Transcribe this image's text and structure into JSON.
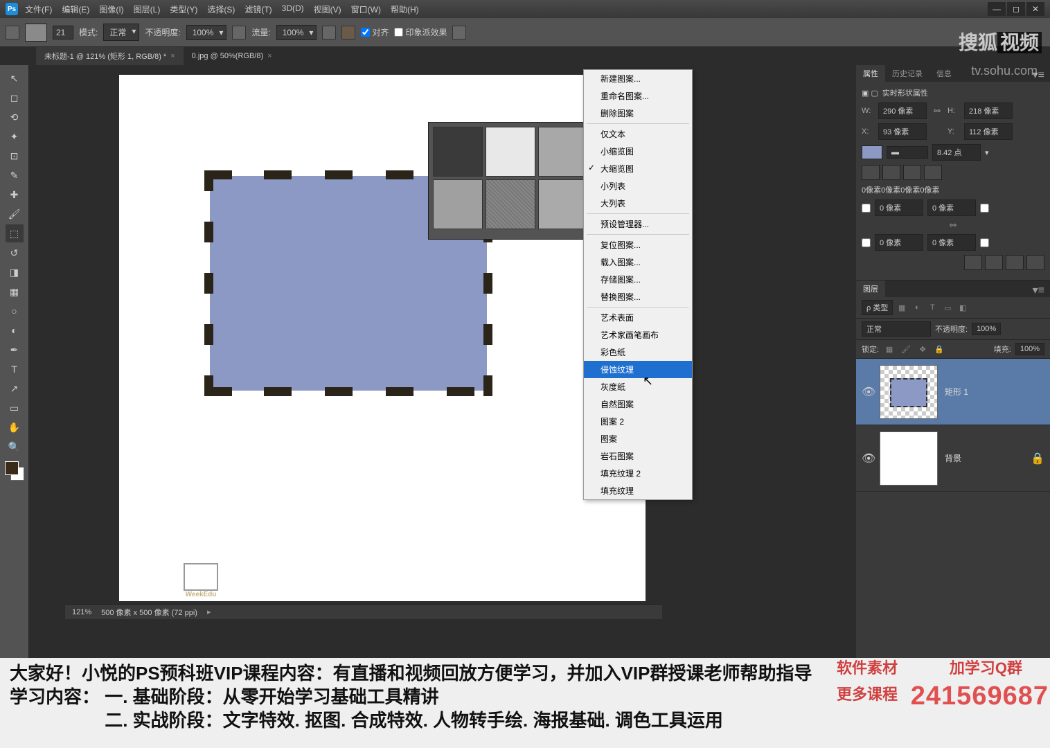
{
  "menu": [
    "文件(F)",
    "编辑(E)",
    "图像(I)",
    "图层(L)",
    "类型(Y)",
    "选择(S)",
    "滤镜(T)",
    "3D(D)",
    "视图(V)",
    "窗口(W)",
    "帮助(H)"
  ],
  "options": {
    "size": "21",
    "mode_label": "模式:",
    "mode_value": "正常",
    "opacity_label": "不透明度:",
    "opacity_value": "100%",
    "flow_label": "流量:",
    "flow_value": "100%",
    "align": "对齐",
    "impress": "印象派效果"
  },
  "tabs": [
    {
      "label": "未标题-1 @ 121% (矩形 1, RGB/8) *",
      "active": true
    },
    {
      "label": "0.jpg @ 50%(RGB/8)",
      "active": false
    }
  ],
  "ctx": {
    "group1": [
      "新建图案...",
      "重命名图案...",
      "删除图案"
    ],
    "group2": [
      "仅文本",
      "小缩览图",
      "大缩览图",
      "小列表",
      "大列表"
    ],
    "checked": "大缩览图",
    "group3": [
      "预设管理器..."
    ],
    "group4": [
      "复位图案...",
      "载入图案...",
      "存储图案...",
      "替换图案..."
    ],
    "group5": [
      "艺术表面",
      "艺术家画笔画布",
      "彩色纸",
      "侵蚀纹理",
      "灰度纸",
      "自然图案",
      "图案 2",
      "图案",
      "岩石图案",
      "填充纹理 2",
      "填充纹理"
    ],
    "highlighted": "侵蚀纹理"
  },
  "props_panel": {
    "tabs": [
      "属性",
      "历史记录",
      "信息"
    ],
    "title": "实时形状属性",
    "W": "290 像素",
    "H": "218 像素",
    "X": "93 像素",
    "Y": "112 像素",
    "stroke": "8.42 点",
    "corners": "0像素0像素0像素0像素",
    "corner_val": "0 像素"
  },
  "layers_panel": {
    "tab": "图层",
    "filter": "ρ 类型",
    "blend": "正常",
    "opacity_label": "不透明度:",
    "opacity": "100%",
    "lock_label": "锁定:",
    "fill_label": "填充:",
    "fill": "100%",
    "layers": [
      {
        "name": "矩形 1",
        "sel": true
      },
      {
        "name": "背景",
        "sel": false,
        "locked": true
      }
    ]
  },
  "statusbar": {
    "zoom": "121%",
    "info": "500 像素 x 500 像素 (72 ppi)"
  },
  "footer": {
    "l1": "大家好！小悦的PS预科班VIP课程内容：有直播和视频回放方便学习，并加入VIP群授课老师帮助指导",
    "l2": "学习内容：  一. 基础阶段：从零开始学习基础工具精讲",
    "l3": "　　　　　  二. 实战阶段：文字特效. 抠图. 合成特效. 人物转手绘. 海报基础. 调色工具运用",
    "brand1": "软件素材",
    "brand2": "更多课程",
    "qun": "加学习Q群",
    "num": "241569687"
  },
  "sohu": {
    "a": "搜狐",
    "b": "视频",
    "url": "tv.sohu.com"
  },
  "weekedu": "WeekEdu"
}
